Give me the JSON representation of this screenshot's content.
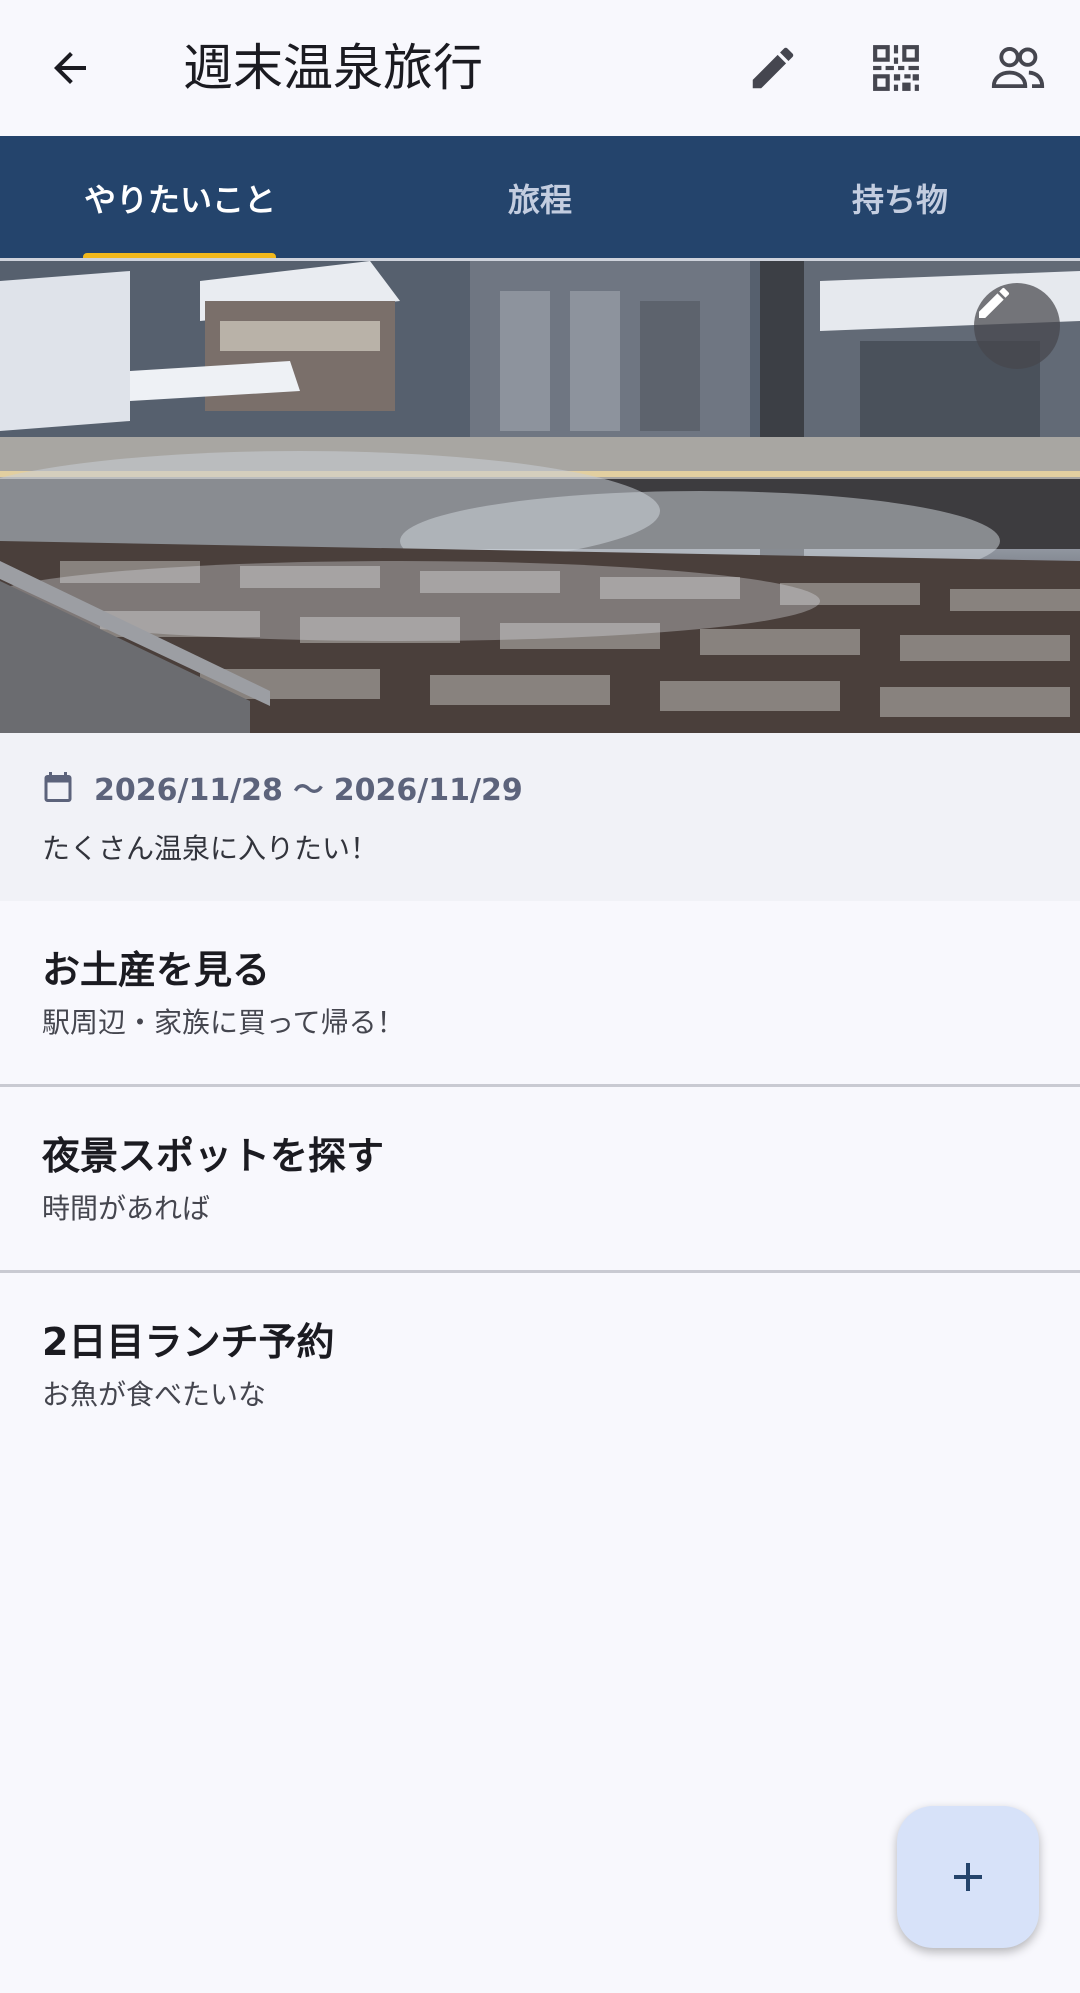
{
  "header": {
    "title": "週末温泉旅行",
    "icons": [
      "back-arrow-icon",
      "pencil-icon",
      "qr-code-icon",
      "people-icon"
    ]
  },
  "tabs": [
    {
      "label": "やりたいこと",
      "active": true
    },
    {
      "label": "旅程",
      "active": false
    },
    {
      "label": "持ち物",
      "active": false
    }
  ],
  "trip": {
    "date_range": "2026/11/28 〜 2026/11/29",
    "memo": "たくさん温泉に入りたい！"
  },
  "todos": [
    {
      "title": "お土産を見る",
      "note": "駅周辺・家族に買って帰る！"
    },
    {
      "title": "夜景スポットを探す",
      "note": "時間があれば"
    },
    {
      "title": "2日目ランチ予約",
      "note": "お魚が食べたいな"
    }
  ],
  "colors": {
    "tab_bar": "#24446c",
    "tab_indicator": "#f1b81c",
    "fab_background": "#d7e2f9",
    "fab_icon": "#24446c"
  }
}
